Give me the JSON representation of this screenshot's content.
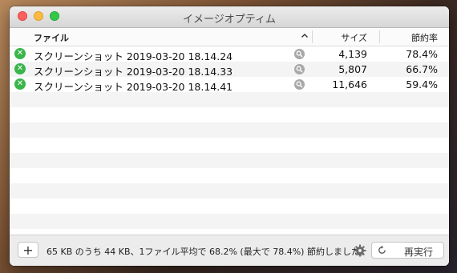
{
  "window": {
    "title": "イメージオプティム"
  },
  "header": {
    "file": "ファイル",
    "size": "サイズ",
    "saving": "節約率"
  },
  "files": [
    {
      "name": "スクリーンショット 2019-03-20 18.14.24",
      "size": "4,139",
      "saving": "78.4%"
    },
    {
      "name": "スクリーンショット 2019-03-20 18.14.33",
      "size": "5,807",
      "saving": "66.7%"
    },
    {
      "name": "スクリーンショット 2019-03-20 18.14.41",
      "size": "11,646",
      "saving": "59.4%"
    }
  ],
  "footer": {
    "add_label": "+",
    "summary": "65 KB のうち 44 KB、1ファイル平均で 68.2% (最大で 78.4%) 節約しました。",
    "again_label": "再実行"
  },
  "icons": {
    "status": "error-x-icon",
    "quicklook": "magnifier-icon",
    "settings": "gear-icon",
    "again": "refresh-icon"
  },
  "colors": {
    "status_green": "#39b54a",
    "close": "#fc605c",
    "minimize": "#fdbc40",
    "maximize": "#34c84a"
  }
}
